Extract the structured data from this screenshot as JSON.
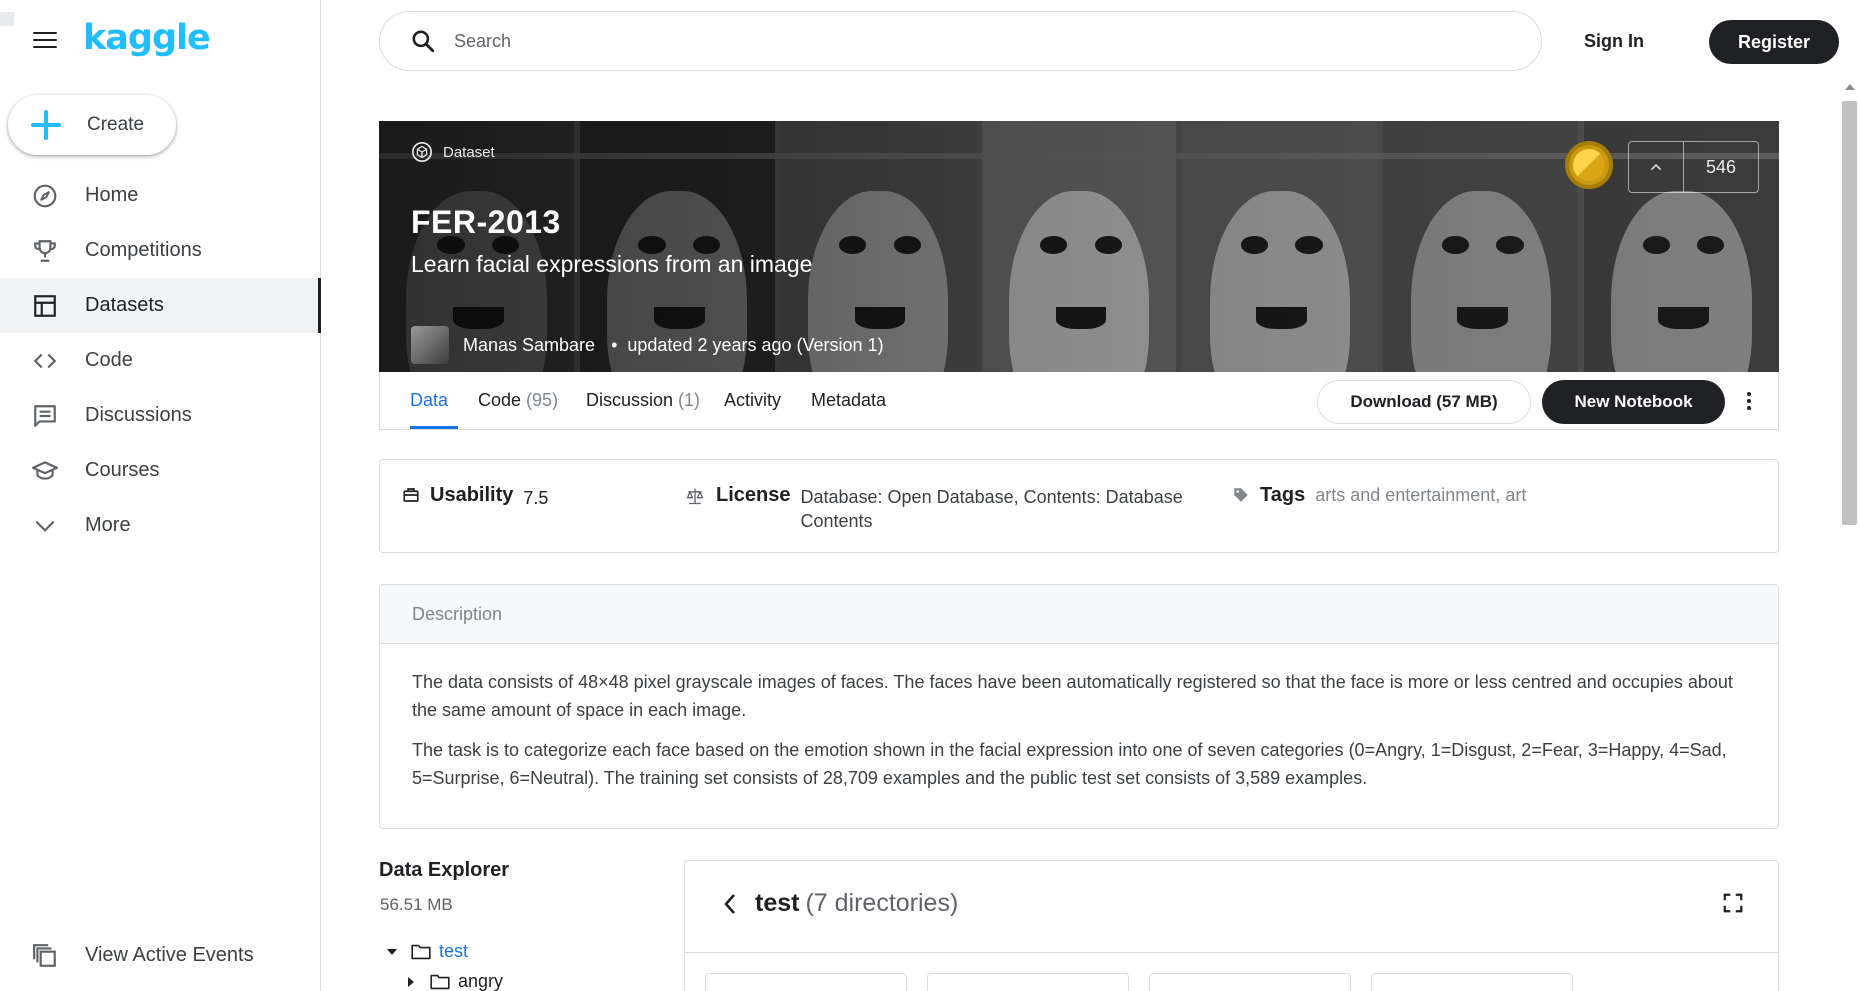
{
  "brand": {
    "logo_text": "kaggle",
    "accent": "#20beff"
  },
  "sidebar": {
    "create_label": "Create",
    "items": [
      {
        "label": "Home",
        "icon": "compass-icon"
      },
      {
        "label": "Competitions",
        "icon": "trophy-icon"
      },
      {
        "label": "Datasets",
        "icon": "table-icon",
        "active": true
      },
      {
        "label": "Code",
        "icon": "code-icon"
      },
      {
        "label": "Discussions",
        "icon": "comment-icon"
      },
      {
        "label": "Courses",
        "icon": "school-icon"
      },
      {
        "label": "More",
        "icon": "chevron-down-icon"
      }
    ],
    "events_label": "View Active Events"
  },
  "header": {
    "search_placeholder": "Search",
    "sign_in": "Sign In",
    "register": "Register"
  },
  "dataset": {
    "type_label": "Dataset",
    "title": "FER-2013",
    "subtitle": "Learn facial expressions from an image",
    "author": "Manas Sambare",
    "updated": "updated 2 years ago (Version 1)",
    "upvotes": "546"
  },
  "tabs": [
    {
      "label": "Data",
      "count": "",
      "active": true
    },
    {
      "label": "Code",
      "count": "(95)"
    },
    {
      "label": "Discussion",
      "count": "(1)"
    },
    {
      "label": "Activity",
      "count": ""
    },
    {
      "label": "Metadata",
      "count": ""
    }
  ],
  "actions": {
    "download": "Download (57 MB)",
    "new_notebook": "New Notebook"
  },
  "meta": {
    "usability_label": "Usability",
    "usability_value": "7.5",
    "license_label": "License",
    "license_value": "Database: Open Database, Contents: Database Contents",
    "tags_label": "Tags",
    "tags": [
      "arts and entertainment",
      "art"
    ]
  },
  "description": {
    "heading": "Description",
    "paragraphs": [
      "The data consists of 48×48 pixel grayscale images of faces. The faces have been automatically registered so that the face is more or less centred and occupies about the same amount of space in each image.",
      "The task is to categorize each face based on the emotion shown in the facial expression into one of seven categories (0=Angry, 1=Disgust, 2=Fear, 3=Happy, 4=Sad, 5=Surprise, 6=Neutral). The training set consists of 28,709 examples and the public test set consists of 3,589 examples."
    ]
  },
  "data_explorer": {
    "title": "Data Explorer",
    "size": "56.51 MB",
    "tree": [
      {
        "name": "test",
        "expanded": true
      },
      {
        "name": "angry",
        "expanded": false
      }
    ],
    "panel_title": "test",
    "panel_subtitle": "(7 directories)"
  }
}
